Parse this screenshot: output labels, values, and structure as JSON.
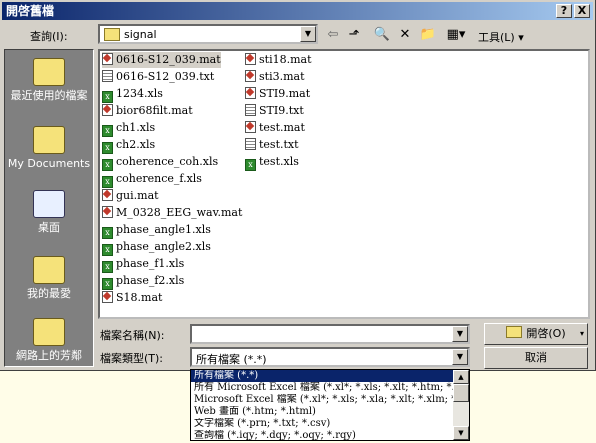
{
  "window": {
    "title": "開啓舊檔",
    "help_label": "?",
    "close_label": "X"
  },
  "lookin": {
    "label": "查詢(I):",
    "folder": "signal"
  },
  "toolbar": {
    "tools_label": "工具(L)"
  },
  "places": [
    "最近使用的檔案",
    "My Documents",
    "桌面",
    "我的最愛",
    "網路上的芳鄰"
  ],
  "files": {
    "col1": [
      {
        "name": "0616-S12_039.mat",
        "type": "mat"
      },
      {
        "name": "0616-S12_039.txt",
        "type": "txt"
      },
      {
        "name": "1234.xls",
        "type": "xls"
      },
      {
        "name": "bior68filt.mat",
        "type": "mat"
      },
      {
        "name": "ch1.xls",
        "type": "xls"
      },
      {
        "name": "ch2.xls",
        "type": "xls"
      },
      {
        "name": "coherence_coh.xls",
        "type": "xls"
      },
      {
        "name": "coherence_f.xls",
        "type": "xls"
      },
      {
        "name": "gui.mat",
        "type": "mat"
      },
      {
        "name": "M_0328_EEG_wav.mat",
        "type": "mat"
      },
      {
        "name": "phase_angle1.xls",
        "type": "xls"
      },
      {
        "name": "phase_angle2.xls",
        "type": "xls"
      },
      {
        "name": "phase_f1.xls",
        "type": "xls"
      },
      {
        "name": "phase_f2.xls",
        "type": "xls"
      },
      {
        "name": "S18.mat",
        "type": "mat"
      }
    ],
    "col2": [
      {
        "name": "sti18.mat",
        "type": "mat"
      },
      {
        "name": "sti3.mat",
        "type": "mat"
      },
      {
        "name": "STI9.mat",
        "type": "mat"
      },
      {
        "name": "STI9.txt",
        "type": "txt"
      },
      {
        "name": "test.mat",
        "type": "mat"
      },
      {
        "name": "test.txt",
        "type": "txt"
      },
      {
        "name": "test.xls",
        "type": "xls"
      }
    ]
  },
  "filename": {
    "label": "檔案名稱(N):",
    "value": ""
  },
  "filetype": {
    "label": "檔案類型(T):",
    "value": "所有檔案 (*.*)",
    "options": [
      "所有檔案 (*.*)",
      "所有 Microsoft Excel 檔案 (*.xl*; *.xls; *.xlt; *.htm; *.",
      "Microsoft Excel 檔案 (*.xl*; *.xls; *.xla; *.xlt; *.xlm; *.",
      "Web 畫面 (*.htm; *.html)",
      "文字檔案 (*.prn; *.txt; *.csv)",
      "查詢檔 (*.iqy; *.dqy; *.oqy; *.rqy)"
    ]
  },
  "buttons": {
    "open": "開啓(O)",
    "cancel": "取消"
  },
  "colors": {
    "titlebar": "#0a246a",
    "face": "#d4d0c8",
    "places_bg": "#808080"
  }
}
